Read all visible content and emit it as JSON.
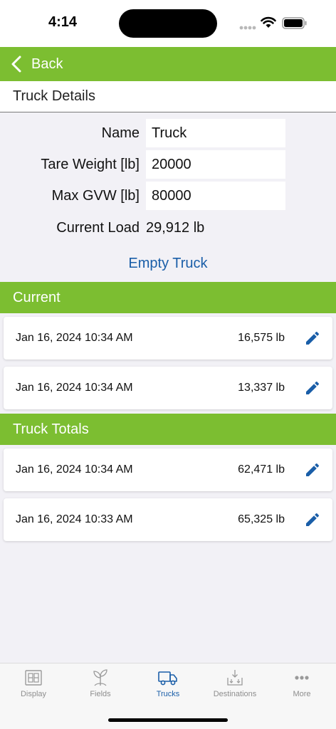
{
  "status_bar": {
    "time": "4:14"
  },
  "nav": {
    "back_label": "Back"
  },
  "details": {
    "title": "Truck Details",
    "name_label": "Name",
    "name_value": "Truck",
    "tare_label": "Tare Weight [lb]",
    "tare_value": "20000",
    "gvw_label": "Max GVW [lb]",
    "gvw_value": "80000",
    "load_label": "Current Load",
    "load_value": "29,912 lb",
    "empty_truck_label": "Empty Truck"
  },
  "current": {
    "title": "Current",
    "items": [
      {
        "date": "Jan 16, 2024 10:34 AM",
        "weight": "16,575 lb"
      },
      {
        "date": "Jan 16, 2024 10:34 AM",
        "weight": "13,337 lb"
      }
    ]
  },
  "totals": {
    "title": "Truck Totals",
    "items": [
      {
        "date": "Jan 16, 2024 10:34 AM",
        "weight": "62,471 lb"
      },
      {
        "date": "Jan 16, 2024 10:33 AM",
        "weight": "65,325 lb"
      }
    ]
  },
  "tabs": [
    {
      "label": "Display",
      "icon": "display-icon",
      "active": false
    },
    {
      "label": "Fields",
      "icon": "sprout-icon",
      "active": false
    },
    {
      "label": "Trucks",
      "icon": "truck-icon",
      "active": true
    },
    {
      "label": "Destinations",
      "icon": "unload-icon",
      "active": false
    },
    {
      "label": "More",
      "icon": "more-dots-icon",
      "active": false
    }
  ],
  "colors": {
    "accent_green": "#7cbe31",
    "link_blue": "#1a5ea8",
    "background": "#f2f1f6"
  }
}
